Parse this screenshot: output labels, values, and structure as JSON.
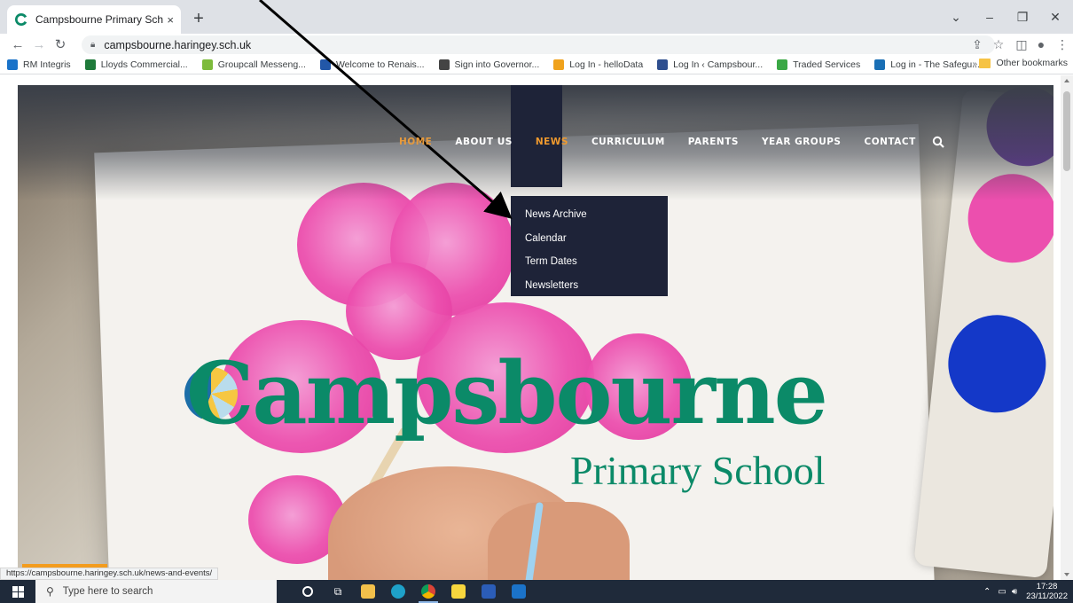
{
  "browser": {
    "tab_title": "Campsbourne Primary School | H",
    "url": "campsbourne.haringey.sch.uk",
    "new_tab": "+",
    "tab_close": "×"
  },
  "bookmarks": [
    {
      "label": "RM Integris",
      "color": "#1a73c9"
    },
    {
      "label": "Lloyds Commercial...",
      "color": "#1f7a3a"
    },
    {
      "label": "Groupcall Messeng...",
      "color": "#7dbb3b"
    },
    {
      "label": "Welcome to Renais...",
      "color": "#2257a8"
    },
    {
      "label": "Sign into Governor...",
      "color": "#444444"
    },
    {
      "label": "Log In - helloData",
      "color": "#f0a21c"
    },
    {
      "label": "Log In ‹ Campsbour...",
      "color": "#2f4f8f"
    },
    {
      "label": "Traded Services",
      "color": "#3aa845"
    },
    {
      "label": "Log in - The Safegu...",
      "color": "#1a6fb5"
    }
  ],
  "bookmarks_more": "»",
  "other_bookmarks": "Other bookmarks",
  "nav": {
    "home": "HOME",
    "about": "ABOUT US",
    "news": "NEWS",
    "curriculum": "CURRICULUM",
    "parents": "PARENTS",
    "year_groups": "YEAR GROUPS",
    "contact": "CONTACT"
  },
  "news_menu": [
    "News Archive",
    "Calendar",
    "Term Dates",
    "Newsletters"
  ],
  "logo": {
    "name": "Campsbourne",
    "subtitle": "Primary School"
  },
  "status_url": "https://campsbourne.haringey.sch.uk/news-and-events/",
  "taskbar": {
    "search_placeholder": "Type here to search",
    "time": "17:28",
    "date": "23/11/2022"
  },
  "colors": {
    "nav_dark": "#1e2338",
    "accent_orange": "#f09a2e",
    "brand_green": "#0b8a68"
  }
}
